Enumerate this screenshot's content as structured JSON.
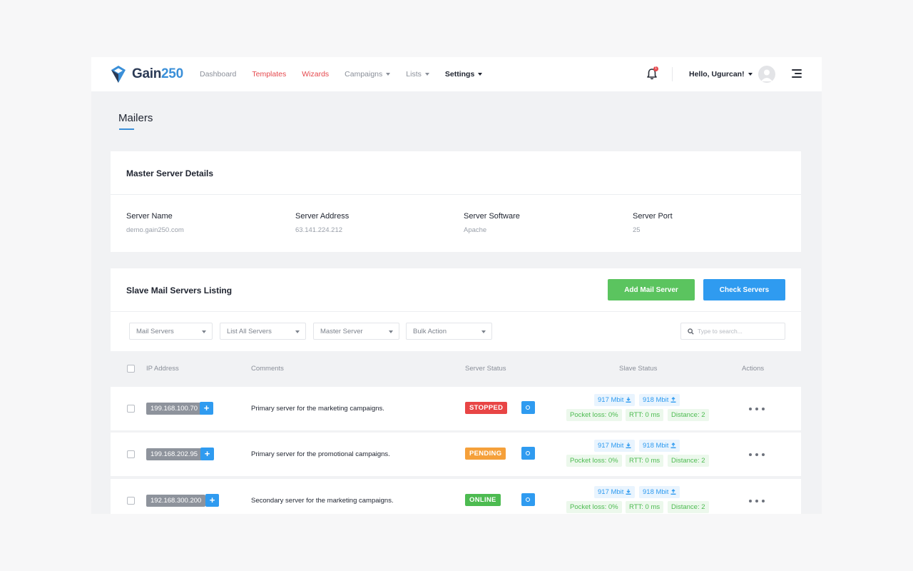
{
  "header": {
    "logo_text": "Gain",
    "logo_num": "250",
    "nav": [
      {
        "label": "Dashboard",
        "style": "muted",
        "dropdown": false
      },
      {
        "label": "Templates",
        "style": "red",
        "dropdown": false
      },
      {
        "label": "Wizards",
        "style": "red",
        "dropdown": false
      },
      {
        "label": "Campaigns",
        "style": "muted",
        "dropdown": true
      },
      {
        "label": "Lists",
        "style": "muted",
        "dropdown": true
      },
      {
        "label": "Settings",
        "style": "dark",
        "dropdown": true
      }
    ],
    "notification_count": "1",
    "greeting": "Hello, Ugurcan!"
  },
  "page_title": "Mailers",
  "master": {
    "title": "Master Server Details",
    "fields": [
      {
        "label": "Server Name",
        "value": "demo.gain250.com"
      },
      {
        "label": "Server Address",
        "value": "63.141.224.212"
      },
      {
        "label": "Server Software",
        "value": "Apache"
      },
      {
        "label": "Server Port",
        "value": "25"
      }
    ]
  },
  "slave": {
    "title": "Slave Mail Servers Listing",
    "add_button": "Add Mail Server",
    "check_button": "Check Servers",
    "filters": [
      "Mail Servers",
      "List All Servers",
      "Master Server",
      "Bulk Action"
    ],
    "search_placeholder": "Type to search...",
    "columns": {
      "ip": "IP Address",
      "comments": "Comments",
      "server_status": "Server Status",
      "slave_status": "Slave Status",
      "actions": "Actions"
    },
    "rows": [
      {
        "ip": "199.168.100.70",
        "comment": "Primary server for the marketing campaigns.",
        "status": "STOPPED",
        "status_color": "#e84545",
        "download": "917 Mbit",
        "upload": "918 Mbit",
        "packet_loss": "Pocket loss: 0%",
        "rtt": "RTT: 0 ms",
        "distance": "Distance: 2"
      },
      {
        "ip": "199.168.202.95",
        "comment": "Primary server for the promotional campaigns.",
        "status": "PENDING",
        "status_color": "#f5a03a",
        "download": "917 Mbit",
        "upload": "918 Mbit",
        "packet_loss": "Pocket loss: 0%",
        "rtt": "RTT: 0 ms",
        "distance": "Distance: 2"
      },
      {
        "ip": "192.168.300.200",
        "comment": "Secondary server for the marketing campaigns.",
        "status": "ONLINE",
        "status_color": "#4dbb51",
        "download": "917 Mbit",
        "upload": "918 Mbit",
        "packet_loss": "Pocket loss: 0%",
        "rtt": "RTT: 0 ms",
        "distance": "Distance: 2"
      }
    ]
  },
  "colors": {
    "accent": "#2f9bf0",
    "success": "#5bc45f",
    "danger": "#e5484d"
  }
}
